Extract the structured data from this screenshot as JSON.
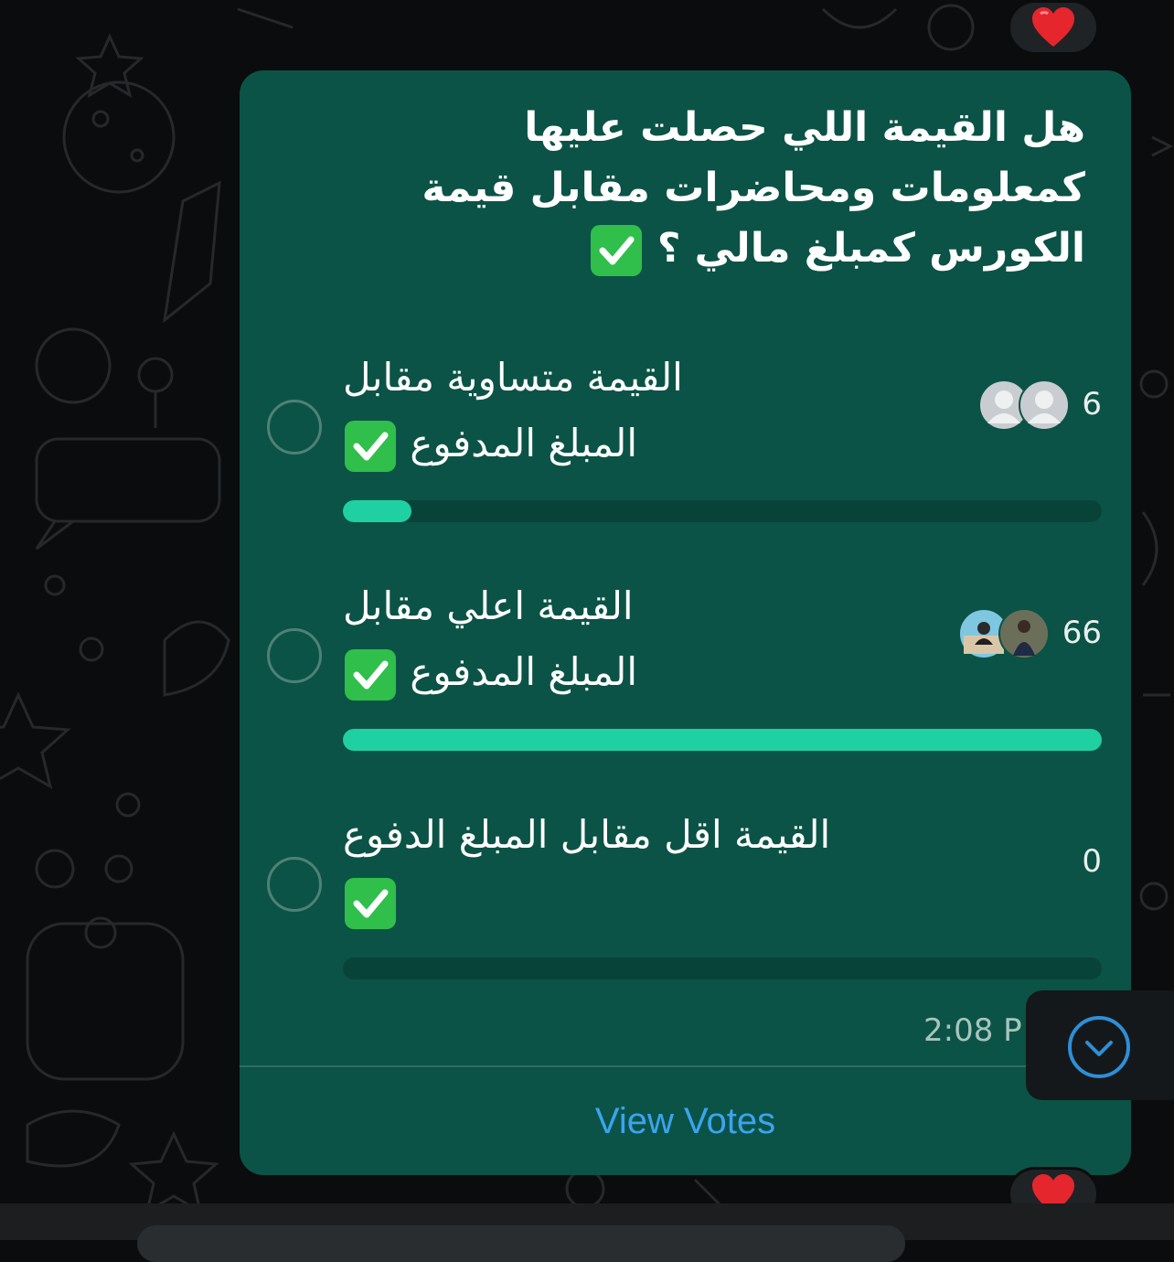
{
  "poll": {
    "question_lines": [
      "هل القيمة اللي حصلت عليها",
      "كمعلومات ومحاضرات مقابل قيمة",
      "الكورس كمبلغ مالي ؟"
    ],
    "options": [
      {
        "line1": "القيمة متساوية مقابل",
        "line2": "المبلغ المدفوع",
        "votes": "6",
        "share": 0.0909
      },
      {
        "line1": "القيمة اعلي مقابل",
        "line2": "المبلغ المدفوع",
        "votes": "66",
        "share": 1.0
      },
      {
        "line1": "القيمة اقل مقابل المبلغ الدفوع",
        "line2": "",
        "votes": "0",
        "share": 0
      }
    ],
    "timestamp": "2:08 P",
    "view_votes_label": "View Votes"
  },
  "reactions": {
    "top": "heart-icon",
    "bottom": "heart-icon"
  },
  "colors": {
    "bubble": "#0b5346",
    "bar_fill": "#1ed0a2",
    "bar_track": "#08433a",
    "link": "#3aa4f0",
    "check": "#2fbf4a"
  }
}
